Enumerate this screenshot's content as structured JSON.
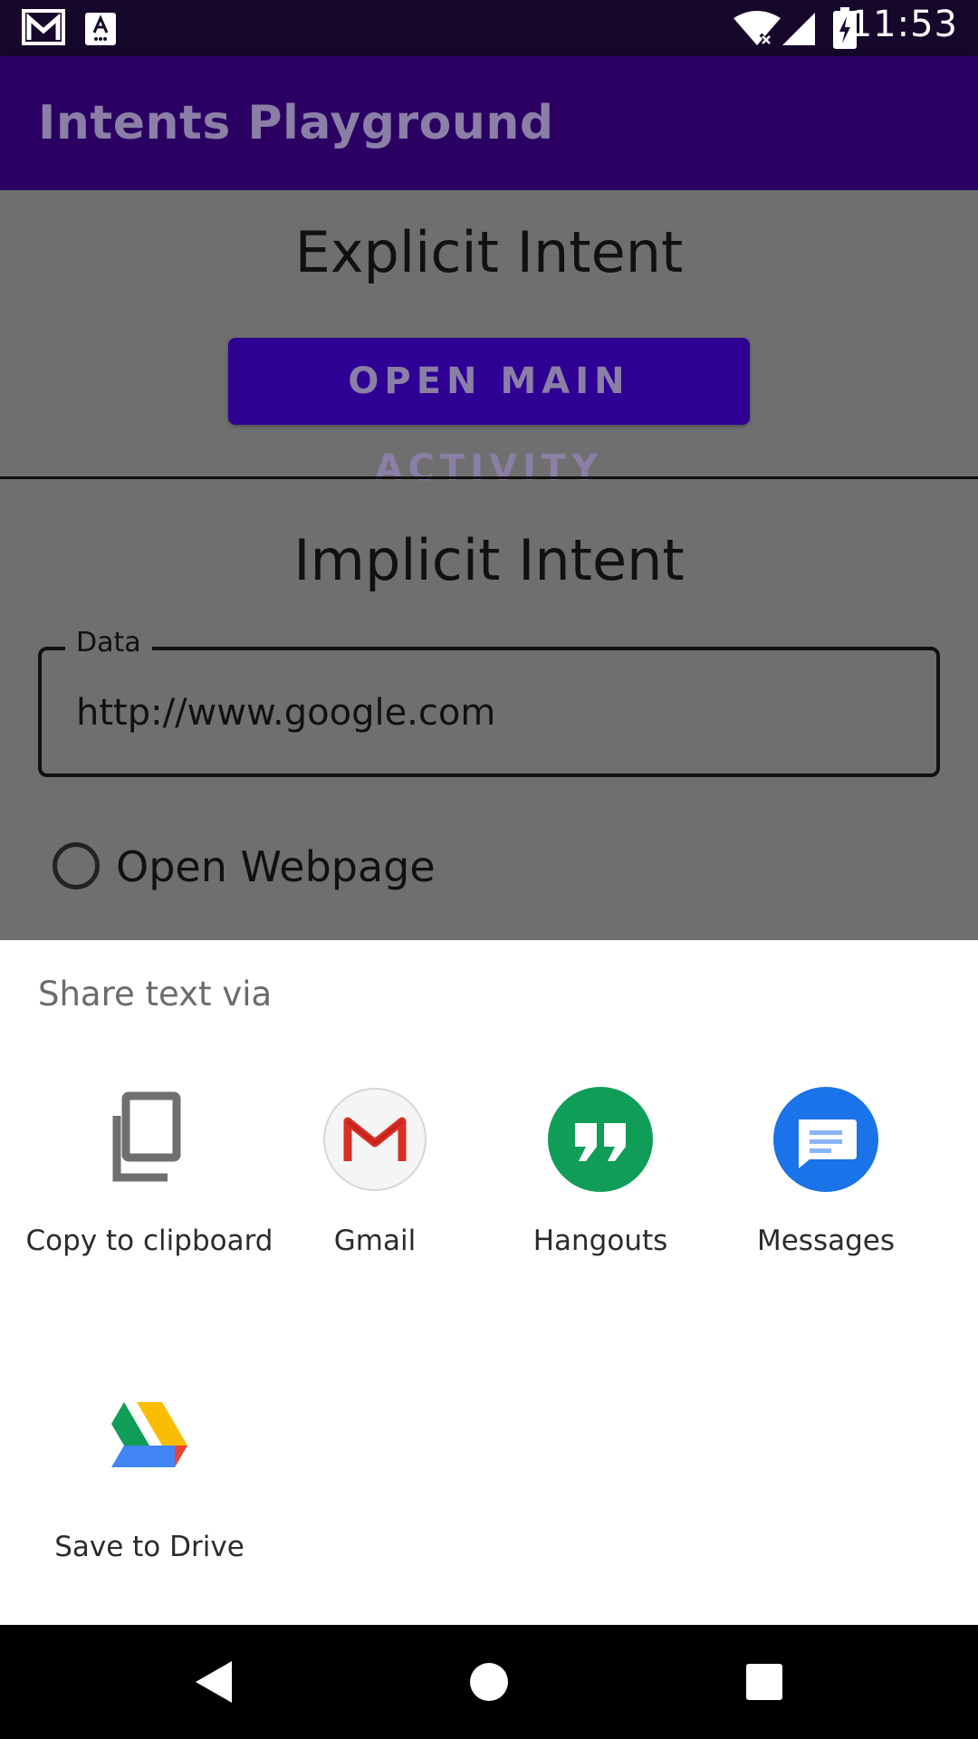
{
  "status_bar": {
    "time": "11:53",
    "icons": [
      "gmail-notification-icon",
      "keyboard-a-icon",
      "wifi-icon",
      "cell-signal-icon",
      "battery-charging-icon"
    ]
  },
  "app_bar": {
    "title": "Intents Playground"
  },
  "explicit": {
    "title": "Explicit Intent",
    "button_label": "OPEN MAIN ACTIVITY"
  },
  "implicit": {
    "title": "Implicit Intent",
    "data_label": "Data",
    "data_value": "http://www.google.com",
    "radio_label": "Open Webpage"
  },
  "share_sheet": {
    "title": "Share text via",
    "targets": [
      {
        "label": "Copy to clipboard",
        "icon": "clipboard-icon"
      },
      {
        "label": "Gmail",
        "icon": "gmail-icon"
      },
      {
        "label": "Hangouts",
        "icon": "hangouts-icon"
      },
      {
        "label": "Messages",
        "icon": "messages-icon"
      },
      {
        "label": "Save to Drive",
        "icon": "drive-icon"
      }
    ]
  },
  "colors": {
    "status_bar": "#16082b",
    "app_bar": "#2a0063",
    "button": "#2e0094",
    "scrim": "#6f6f6f",
    "hangouts_green": "#0f9d58",
    "messages_blue": "#1a73e8",
    "gmail_red": "#d93025"
  },
  "nav_bar": {
    "buttons": [
      "back-icon",
      "home-icon",
      "recents-icon"
    ]
  }
}
